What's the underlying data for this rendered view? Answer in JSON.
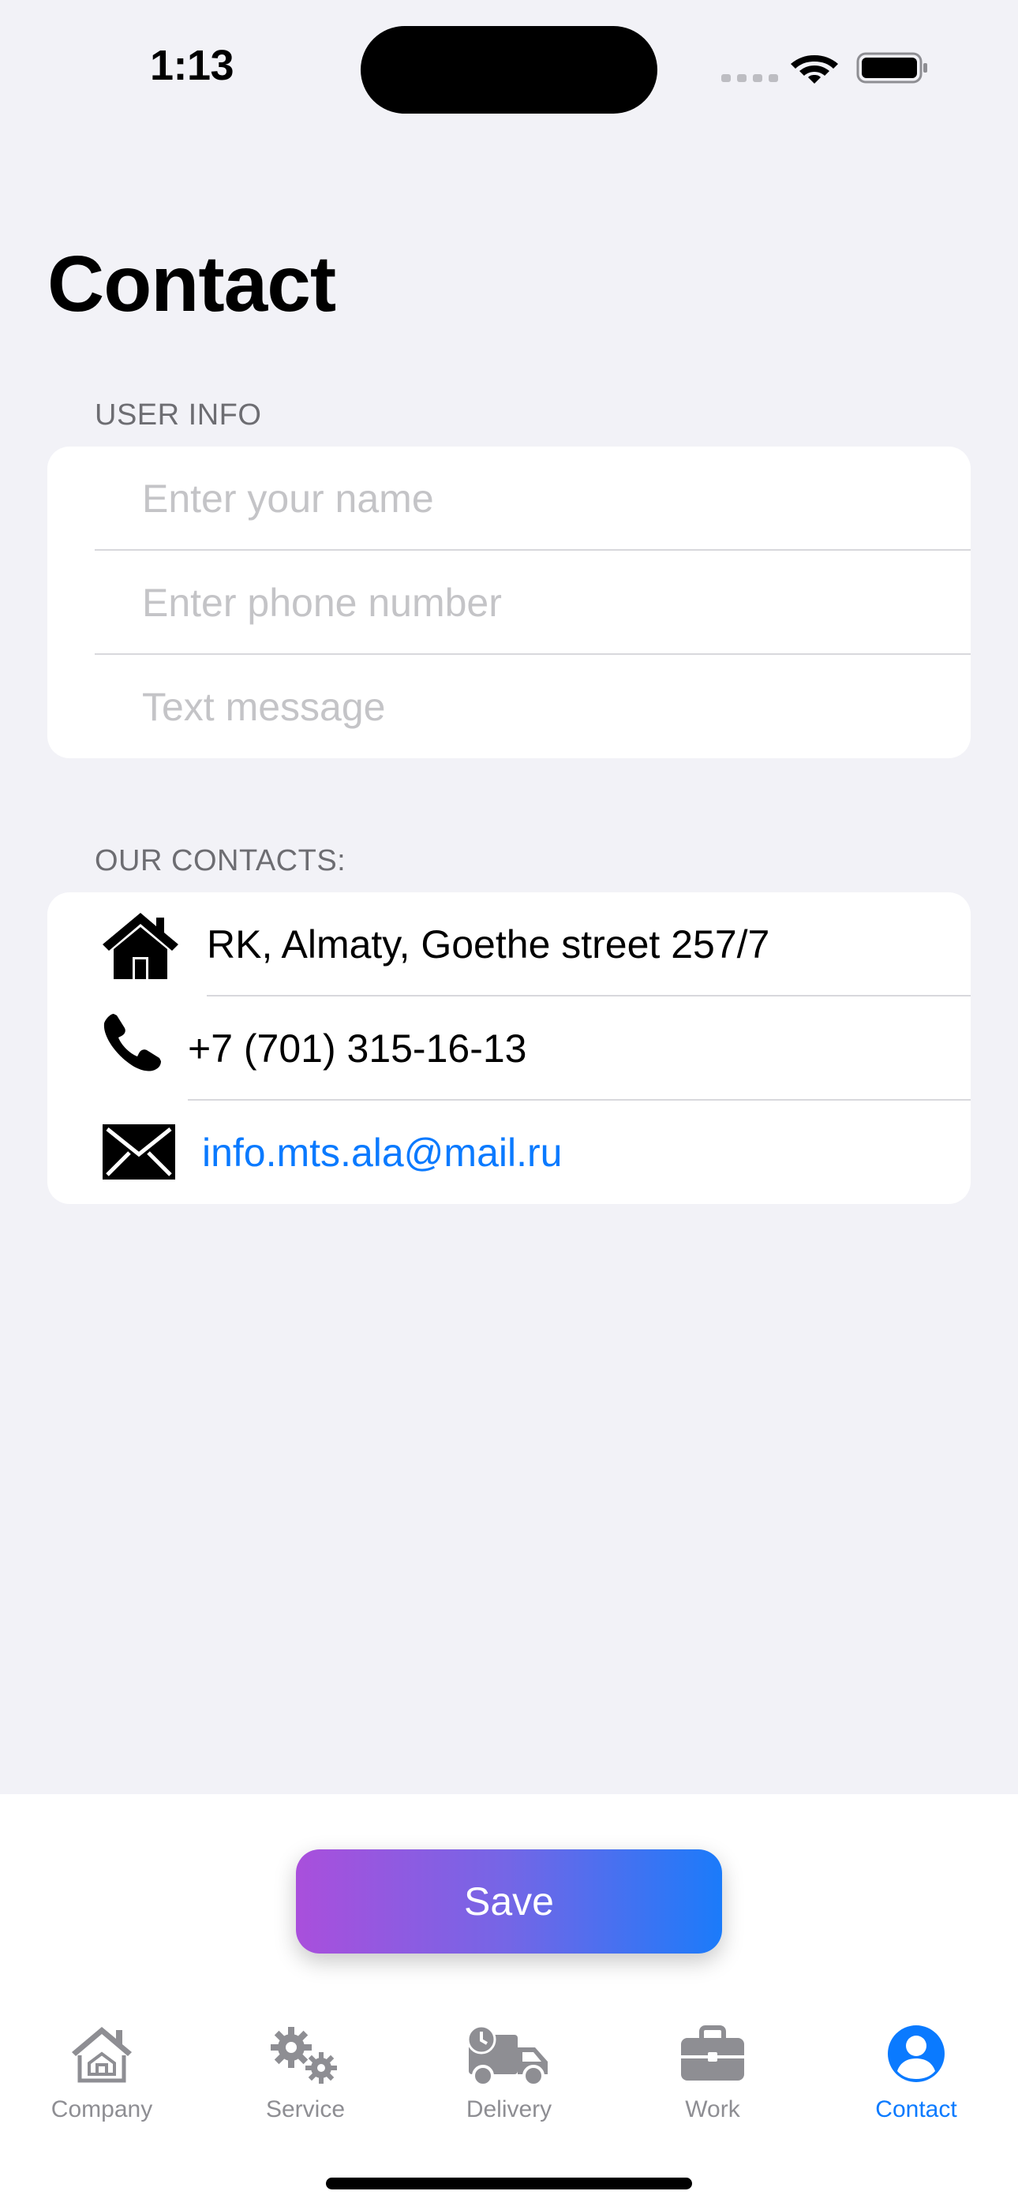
{
  "status_bar": {
    "time": "1:13"
  },
  "page": {
    "title": "Contact"
  },
  "user_info": {
    "header": "USER INFO",
    "name_placeholder": "Enter your name",
    "phone_placeholder": "Enter phone number",
    "message_placeholder": "Text message"
  },
  "contacts": {
    "header": "OUR CONTACTS:",
    "address": "RK, Almaty, Goethe street 257/7",
    "phone": "+7 (701) 315-16-13",
    "email": "info.mts.ala@mail.ru"
  },
  "save_label": "Save",
  "tabs": [
    {
      "label": "Company",
      "icon": "house-icon",
      "active": false
    },
    {
      "label": "Service",
      "icon": "gears-icon",
      "active": false
    },
    {
      "label": "Delivery",
      "icon": "truck-icon",
      "active": false
    },
    {
      "label": "Work",
      "icon": "briefcase-icon",
      "active": false
    },
    {
      "label": "Contact",
      "icon": "person-circle-icon",
      "active": true
    }
  ],
  "colors": {
    "accent": "#0a7aff",
    "background": "#f2f2f7",
    "gradient_start": "#a94fdc",
    "gradient_end": "#1b7bfa"
  }
}
